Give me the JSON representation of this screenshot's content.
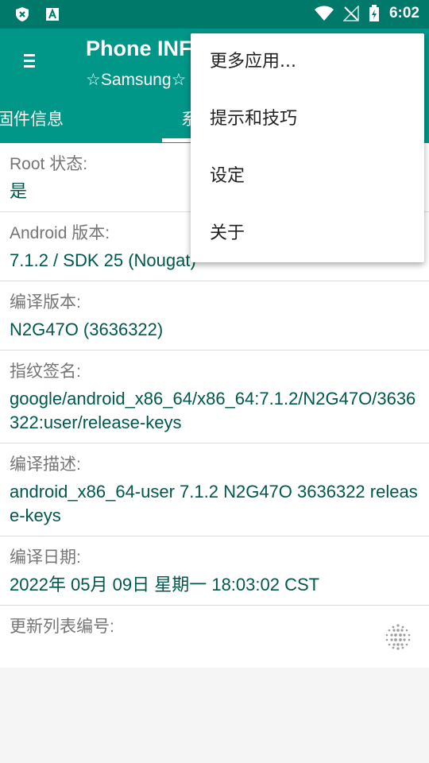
{
  "status_bar": {
    "time": "6:02",
    "left_icons": [
      "shield-x-icon",
      "app-a-icon"
    ],
    "right_icons": [
      "wifi-icon",
      "no-signal-icon",
      "battery-charging-icon"
    ]
  },
  "app_bar": {
    "title": "Phone INF",
    "subtitle": "☆Samsung☆"
  },
  "tabs": [
    {
      "label": "固件信息"
    },
    {
      "label": "系"
    }
  ],
  "rows": [
    {
      "label": "Root 状态:",
      "value": "是"
    },
    {
      "label": "Android 版本:",
      "value": "7.1.2 / SDK 25 (Nougat)"
    },
    {
      "label": "编译版本:",
      "value": "N2G47O (3636322)"
    },
    {
      "label": "指纹签名:",
      "value": "google/android_x86_64/x86_64:7.1.2/N2G47O/3636322:user/release-keys"
    },
    {
      "label": "编译描述:",
      "value": "android_x86_64-user 7.1.2 N2G47O 3636322 release-keys"
    },
    {
      "label": "编译日期:",
      "value": "2022年 05月 09日 星期一 18:03:02 CST"
    },
    {
      "label": "更新列表编号:",
      "value": ""
    }
  ],
  "overflow_menu": {
    "items": [
      "更多应用...",
      "提示和技巧",
      "设定",
      "关于"
    ]
  },
  "colors": {
    "status_bar": "#00796b",
    "app_bar": "#009688",
    "value_text": "#00574b"
  }
}
